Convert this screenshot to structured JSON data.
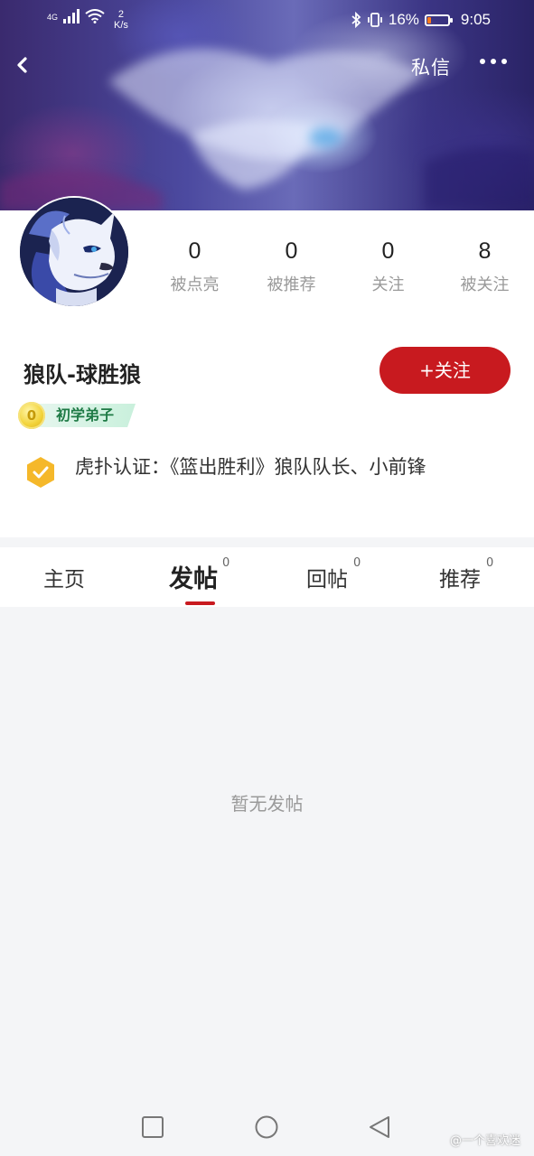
{
  "status_bar": {
    "network": "4G",
    "speed_value": "2",
    "speed_unit": "K/s",
    "battery_percent": "16%",
    "battery_level": 0.16,
    "time": "9:05"
  },
  "nav": {
    "message_label": "私信"
  },
  "profile": {
    "username": "狼队-球胜狼",
    "follow_label": "+关注",
    "level_coin": "0",
    "level_label": "初学弟子",
    "verification_text": "虎扑认证：《篮出胜利》狼队队长、小前锋"
  },
  "stats": [
    {
      "value": "0",
      "label": "被点亮"
    },
    {
      "value": "0",
      "label": "被推荐"
    },
    {
      "value": "0",
      "label": "关注"
    },
    {
      "value": "8",
      "label": "被关注"
    }
  ],
  "tabs": [
    {
      "label": "主页",
      "count": ""
    },
    {
      "label": "发帖",
      "count": "0"
    },
    {
      "label": "回帖",
      "count": "0"
    },
    {
      "label": "推荐",
      "count": "0"
    }
  ],
  "content": {
    "empty_message": "暂无发帖"
  },
  "watermark": "@一个喜欢迷",
  "colors": {
    "accent": "#c81a1f",
    "verify_badge": "#f5b82a",
    "level_text": "#1e7a45"
  }
}
